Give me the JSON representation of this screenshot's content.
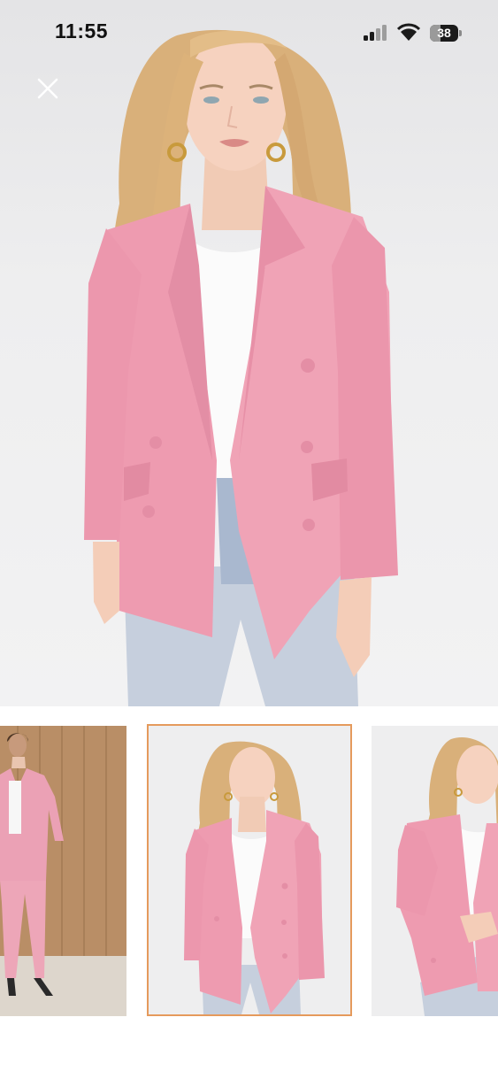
{
  "status_bar": {
    "time": "11:55",
    "battery_level": "38",
    "battery_fraction": 0.38,
    "icons": [
      "signal-icon",
      "wifi-icon",
      "battery-icon"
    ]
  },
  "viewer": {
    "close_icon": "close-icon",
    "selected_thumbnail_index": 1,
    "thumbnail_count": 3
  },
  "colors": {
    "blazer_pink": "#ee9bb0",
    "selected_border": "#e59a5c"
  }
}
